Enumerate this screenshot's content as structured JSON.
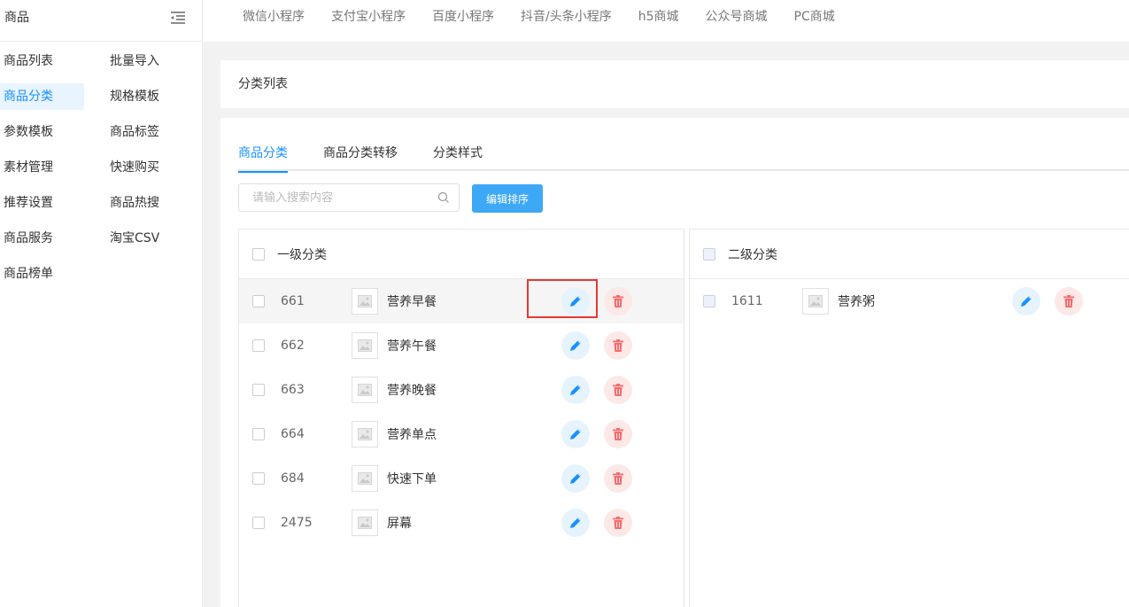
{
  "sidebar": {
    "title": "商品",
    "col1": [
      {
        "label": "商品列表",
        "active": false
      },
      {
        "label": "商品分类",
        "active": true
      },
      {
        "label": "参数模板",
        "active": false
      },
      {
        "label": "素材管理",
        "active": false
      },
      {
        "label": "推荐设置",
        "active": false
      },
      {
        "label": "商品服务",
        "active": false
      },
      {
        "label": "商品榜单",
        "active": false
      }
    ],
    "col2": [
      {
        "label": "批量导入"
      },
      {
        "label": "规格模板"
      },
      {
        "label": "商品标签"
      },
      {
        "label": "快速购买"
      },
      {
        "label": "商品热搜"
      },
      {
        "label": "淘宝CSV"
      }
    ]
  },
  "topnav": [
    "微信小程序",
    "支付宝小程序",
    "百度小程序",
    "抖音/头条小程序",
    "h5商城",
    "公众号商城",
    "PC商城"
  ],
  "card_title": "分类列表",
  "tabs": [
    "商品分类",
    "商品分类转移",
    "分类样式"
  ],
  "search": {
    "placeholder": "请输入搜索内容"
  },
  "sort_button": "编辑排序",
  "level1": {
    "title": "一级分类",
    "rows": [
      {
        "id": "661",
        "name": "营养早餐"
      },
      {
        "id": "662",
        "name": "营养午餐"
      },
      {
        "id": "663",
        "name": "营养晚餐"
      },
      {
        "id": "664",
        "name": "营养单点"
      },
      {
        "id": "684",
        "name": "快速下单"
      },
      {
        "id": "2475",
        "name": "屏幕"
      }
    ]
  },
  "level2": {
    "title": "二级分类",
    "rows": [
      {
        "id": "1611",
        "name": "营养粥"
      }
    ]
  },
  "colors": {
    "accent": "#1890ff",
    "danger": "#f56c6c",
    "highlight": "#e53935"
  }
}
